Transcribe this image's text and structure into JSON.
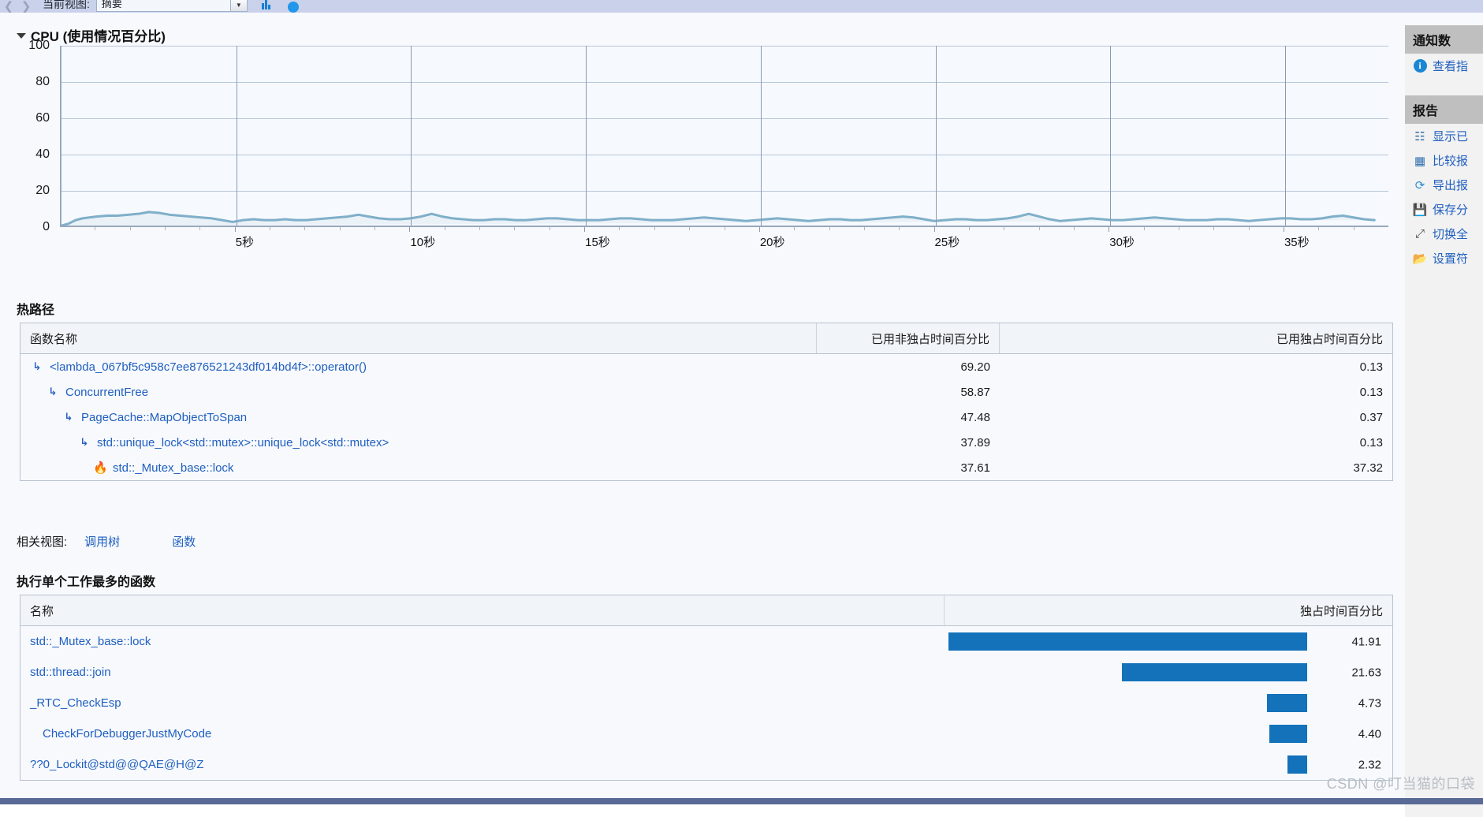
{
  "toolbar": {
    "back_icon": "chevron-left-icon",
    "forward_icon": "chevron-right-icon",
    "view_label": "当前视图:",
    "view_value": "摘要",
    "dropdown_arrow": "▼",
    "chart_icon": "bar-chart-icon",
    "status_icon": "circle-icon"
  },
  "cpu": {
    "title": "CPU (使用情况百分比)",
    "collapse_icon": "triangle-collapse-icon"
  },
  "chart_data": {
    "type": "line",
    "title": "CPU (使用情况百分比)",
    "xlabel": "",
    "ylabel": "",
    "ylim": [
      0,
      100
    ],
    "yticks": [
      100,
      80,
      60,
      40,
      20,
      0
    ],
    "xlim": [
      0,
      38
    ],
    "xticks": [
      5,
      10,
      15,
      20,
      25,
      30,
      35
    ],
    "xticklabels": [
      "5秒",
      "10秒",
      "15秒",
      "20秒",
      "25秒",
      "30秒",
      "35秒"
    ],
    "grid": true,
    "legend": "none",
    "series": [
      {
        "name": "CPU",
        "color": "#7fafc9",
        "x": [
          0.0,
          0.2,
          0.4,
          0.6,
          0.8,
          1.0,
          1.3,
          1.6,
          1.9,
          2.2,
          2.5,
          2.8,
          3.1,
          3.4,
          3.7,
          4.0,
          4.3,
          4.6,
          4.9,
          5.2,
          5.5,
          5.8,
          6.1,
          6.4,
          6.7,
          7.0,
          7.3,
          7.6,
          7.9,
          8.2,
          8.5,
          8.8,
          9.1,
          9.4,
          9.7,
          10.0,
          10.3,
          10.6,
          10.9,
          11.2,
          11.5,
          11.8,
          12.1,
          12.4,
          12.7,
          13.0,
          13.3,
          13.6,
          13.9,
          14.2,
          14.5,
          14.8,
          15.1,
          15.4,
          15.7,
          16.0,
          16.3,
          16.6,
          16.9,
          17.2,
          17.5,
          17.8,
          18.1,
          18.4,
          18.7,
          19.0,
          19.3,
          19.6,
          19.9,
          20.2,
          20.5,
          20.8,
          21.1,
          21.4,
          21.7,
          22.0,
          22.3,
          22.6,
          22.9,
          23.2,
          23.5,
          23.8,
          24.1,
          24.4,
          24.7,
          25.0,
          25.3,
          25.6,
          25.9,
          26.2,
          26.5,
          26.8,
          27.1,
          27.4,
          27.7,
          28.0,
          28.3,
          28.6,
          28.9,
          29.2,
          29.5,
          29.8,
          30.1,
          30.4,
          30.7,
          31.0,
          31.3,
          31.6,
          31.9,
          32.2,
          32.5,
          32.8,
          33.1,
          33.4,
          33.7,
          34.0,
          34.3,
          34.6,
          34.9,
          35.2,
          35.5,
          35.8,
          36.1,
          36.4,
          36.7,
          37.0,
          37.3,
          37.6,
          38.0
        ],
        "y": [
          0,
          1,
          3,
          4,
          4.5,
          5,
          5.5,
          5.5,
          6,
          6.5,
          7.5,
          7,
          6,
          5.5,
          5,
          4.5,
          4,
          3,
          2,
          3,
          3.5,
          3,
          3,
          3.5,
          3,
          3,
          3.5,
          4,
          4.5,
          5,
          6,
          5,
          4,
          3.5,
          3.5,
          4,
          5,
          6.5,
          5,
          4,
          3.5,
          3,
          3,
          3.5,
          3.5,
          3,
          3,
          3.5,
          4,
          4,
          3.5,
          3,
          3,
          3,
          3.5,
          4,
          4,
          3.5,
          3,
          3,
          3,
          3.5,
          4,
          4.5,
          4,
          3.5,
          3,
          2.5,
          3,
          3.5,
          4,
          3.5,
          3,
          2.5,
          3,
          3.5,
          3.5,
          3,
          3,
          3.5,
          4,
          4.5,
          5,
          4.5,
          3.5,
          2.5,
          3,
          3.5,
          3.5,
          3,
          3,
          3.5,
          4,
          5,
          6.5,
          5,
          3.5,
          2.5,
          3,
          3.5,
          4,
          3.5,
          3,
          3,
          3.5,
          4,
          4.5,
          4,
          3.5,
          3,
          3,
          3,
          3.5,
          3.5,
          3,
          2.5,
          3,
          3.5,
          4,
          4,
          3.5,
          3.5,
          4,
          5,
          5.5,
          4.5,
          3.5,
          3
        ]
      }
    ]
  },
  "hotpath": {
    "title": "热路径",
    "columns": [
      "函数名称",
      "已用非独占时间百分比",
      "已用独占时间百分比"
    ],
    "rows": [
      {
        "name": "<lambda_067bf5c958c7ee876521243df014bd4f>::operator()",
        "inclusive": "69.20",
        "exclusive": "0.13",
        "depth": 0,
        "icon": "call-arrow-icon"
      },
      {
        "name": "ConcurrentFree",
        "inclusive": "58.87",
        "exclusive": "0.13",
        "depth": 1,
        "icon": "call-arrow-icon"
      },
      {
        "name": "PageCache::MapObjectToSpan",
        "inclusive": "47.48",
        "exclusive": "0.37",
        "depth": 2,
        "icon": "call-arrow-icon"
      },
      {
        "name": "std::unique_lock<std::mutex>::unique_lock<std::mutex>",
        "inclusive": "37.89",
        "exclusive": "0.13",
        "depth": 3,
        "icon": "call-arrow-icon"
      },
      {
        "name": "std::_Mutex_base::lock",
        "inclusive": "37.61",
        "exclusive": "37.32",
        "depth": 4,
        "icon": "flame-icon"
      }
    ]
  },
  "related_views": {
    "label": "相关视图:",
    "links": [
      "调用树",
      "函数"
    ]
  },
  "functions": {
    "title": "执行单个工作最多的函数",
    "columns": [
      "名称",
      "独占时间百分比"
    ],
    "max_value": 41.91,
    "bar_color": "#1372ba",
    "rows": [
      {
        "name": "std::_Mutex_base::lock",
        "value": "41.91",
        "pct": 41.91,
        "indent": false
      },
      {
        "name": "std::thread::join",
        "value": "21.63",
        "pct": 21.63,
        "indent": false
      },
      {
        "name": "_RTC_CheckEsp",
        "value": "4.73",
        "pct": 4.73,
        "indent": false
      },
      {
        "name": "CheckForDebuggerJustMyCode",
        "value": "4.40",
        "pct": 4.4,
        "indent": true
      },
      {
        "name": "??0_Lockit@std@@QAE@H@Z",
        "value": "2.32",
        "pct": 2.32,
        "indent": false
      }
    ]
  },
  "sidebar": {
    "groups": [
      {
        "title": "通知数",
        "items": [
          {
            "label": "查看指",
            "icon": "info-icon"
          }
        ]
      },
      {
        "title": "报告",
        "items": [
          {
            "label": "显示已",
            "icon": "list-icon"
          },
          {
            "label": "比较报",
            "icon": "compare-icon"
          },
          {
            "label": "导出报",
            "icon": "export-icon"
          },
          {
            "label": "保存分",
            "icon": "save-icon"
          },
          {
            "label": "切换全",
            "icon": "fullscreen-icon"
          },
          {
            "label": "设置符",
            "icon": "folder-icon"
          }
        ]
      }
    ]
  },
  "watermark": "CSDN @叮当猫的口袋"
}
